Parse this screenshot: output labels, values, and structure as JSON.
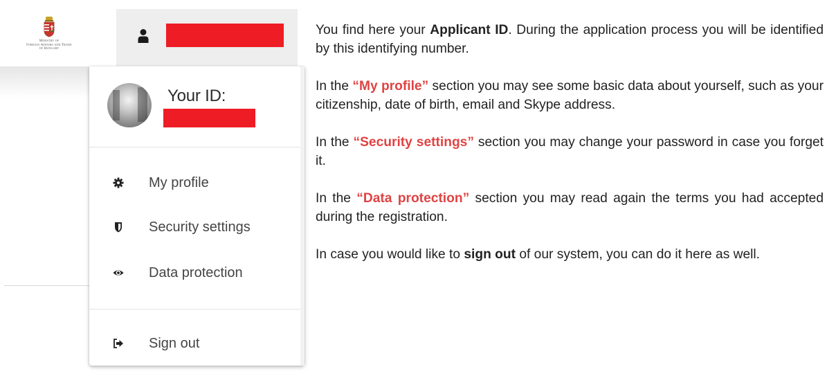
{
  "logo": {
    "lines": [
      "Ministry of",
      "Foreign Affairs and Trade",
      "of Hungary"
    ]
  },
  "header": {
    "user_icon": "user-icon"
  },
  "dropdown": {
    "your_id_label": "Your ID:",
    "menu": [
      {
        "label": "My profile",
        "icon": "gear-icon"
      },
      {
        "label": "Security settings",
        "icon": "shield-icon"
      },
      {
        "label": "Data protection",
        "icon": "eye-icon"
      },
      {
        "label": "Sign out",
        "icon": "sign-out-icon"
      }
    ]
  },
  "colors": {
    "redaction": "#ee1c25",
    "highlight": "#e04343"
  },
  "instructions": {
    "p1": {
      "pre": "You find here your ",
      "strong": "Applicant ID",
      "post": ". During the application process you will be identified by this identifying number."
    },
    "p2": {
      "pre": "In the ",
      "highlight": "“My profile”",
      "post": " section you may see some basic data about yourself, such as your citizenship, date of birth, email and Skype address."
    },
    "p3": {
      "pre": "In the ",
      "highlight": "“Security settings”",
      "post": " section you may change your password in case you forget it."
    },
    "p4": {
      "pre": "In the ",
      "highlight": "“Data protection”",
      "post": " section you may read again the terms you had accepted during the registration."
    },
    "p5": {
      "pre": "In case you would like to ",
      "strong": "sign out",
      "post": " of our system, you can do it here as well."
    }
  }
}
